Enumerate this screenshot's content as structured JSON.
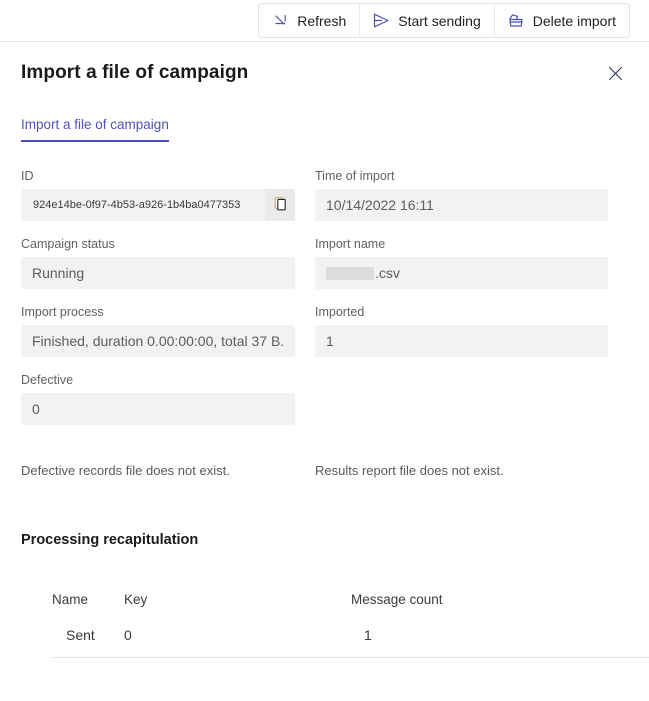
{
  "commandbar": {
    "buttons": [
      {
        "label": "Refresh",
        "icon": "refresh-icon"
      },
      {
        "label": "Start sending",
        "icon": "send-icon"
      },
      {
        "label": "Delete import",
        "icon": "delete-icon"
      }
    ]
  },
  "panel": {
    "title": "Import a file of campaign",
    "close_icon": "close-icon",
    "tabs": [
      {
        "label": "Import a file of campaign",
        "selected": true
      }
    ]
  },
  "form": {
    "id": {
      "label": "ID",
      "value": "924e14be-0f97-4b53-a926-1b4ba0477353",
      "copy_icon": "copy-icon"
    },
    "time_of_import": {
      "label": "Time of import",
      "value": "10/14/2022 16:11"
    },
    "campaign_status": {
      "label": "Campaign status",
      "value": "Running"
    },
    "import_name": {
      "label": "Import name",
      "value": ".csv",
      "redacted": true
    },
    "import_process": {
      "label": "Import process",
      "value": "Finished, duration 0.00:00:00, total 37 B."
    },
    "imported": {
      "label": "Imported",
      "value": "1"
    },
    "defective": {
      "label": "Defective",
      "value": "0"
    }
  },
  "notes": {
    "defective_file": "Defective records file does not exist.",
    "results_file": "Results report file does not exist."
  },
  "recap": {
    "title": "Processing recapitulation",
    "columns": [
      "Name",
      "Key",
      "Message count"
    ],
    "rows": [
      {
        "name": "Sent",
        "key": "0",
        "message_count": "1"
      }
    ]
  },
  "colors": {
    "accent": "#464eb8",
    "field_bg": "#f3f2f1",
    "label": "#616161"
  }
}
